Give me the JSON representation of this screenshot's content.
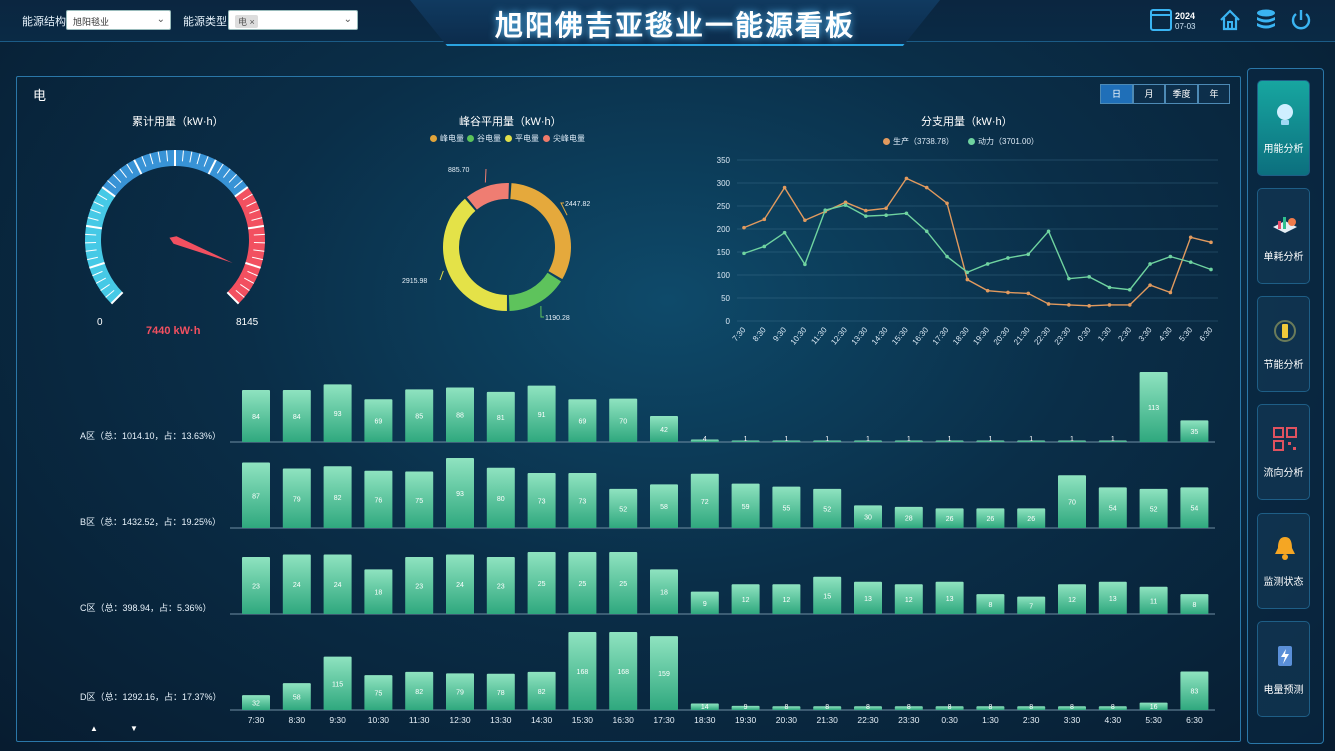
{
  "header": {
    "title": "旭阳佛吉亚毯业一能源看板",
    "structure_label": "能源结构",
    "structure_value": "旭阳毯业",
    "type_label": "能源类型",
    "type_value": "电",
    "date_year": "2024",
    "date_md": "07-03",
    "icons": [
      "calendar-icon",
      "home-icon",
      "database-icon",
      "power-icon"
    ]
  },
  "panel": {
    "title": "电",
    "periods": [
      "日",
      "月",
      "季度",
      "年"
    ],
    "active_period": "日"
  },
  "sidebar": [
    {
      "label": "用能分析",
      "icon": "bulb-icon",
      "active": true
    },
    {
      "label": "单耗分析",
      "icon": "chart-3d-icon",
      "active": false
    },
    {
      "label": "节能分析",
      "icon": "battery-icon",
      "active": false
    },
    {
      "label": "流向分析",
      "icon": "flow-grid-icon",
      "active": false
    },
    {
      "label": "监测状态",
      "icon": "bell-icon",
      "active": false
    },
    {
      "label": "电量预测",
      "icon": "forecast-icon",
      "active": false
    }
  ],
  "colors": {
    "accent": "#3ab4f2",
    "gauge_red": "#f25060",
    "bar_top": "#8fe3c0",
    "bar_bottom": "#2fa87e",
    "prod": "#e29a5e",
    "power": "#6fd3a0"
  },
  "chart_data": [
    {
      "type": "gauge",
      "title": "累计用量（kW·h）",
      "min": 0,
      "max": 8145,
      "value": 7440,
      "value_label": "7440 kW·h",
      "min_label": "0",
      "max_label": "8145"
    },
    {
      "type": "pie",
      "title": "峰谷平用量（kW·h）",
      "legend": [
        "峰电量",
        "谷电量",
        "平电量",
        "尖峰电量"
      ],
      "legend_colors": [
        "#e0a43a",
        "#5cc35a",
        "#e0e04a",
        "#ef7a6a"
      ],
      "slices": [
        {
          "name": "峰电量",
          "value": 2447.82,
          "label": "2447.82",
          "color": "#e5a93c"
        },
        {
          "name": "谷电量",
          "value": 1190.28,
          "label": "1190.28",
          "color": "#5ec35c"
        },
        {
          "name": "平电量",
          "value": 2915.98,
          "label": "2915.98",
          "color": "#e4e248"
        },
        {
          "name": "尖峰电量",
          "value": 885.7,
          "label": "885.70",
          "color": "#ef7d72"
        }
      ]
    },
    {
      "type": "line",
      "title": "分支用量（kW·h）",
      "legend": [
        "生产（3738.78）",
        "动力（3701.00）"
      ],
      "x": [
        "7:30",
        "8:30",
        "9:30",
        "10:30",
        "11:30",
        "12:30",
        "13:30",
        "14:30",
        "15:30",
        "16:30",
        "17:30",
        "18:30",
        "19:30",
        "20:30",
        "21:30",
        "22:30",
        "23:30",
        "0:30",
        "1:30",
        "2:30",
        "3:30",
        "4:30",
        "5:30",
        "6:30"
      ],
      "yticks": [
        "350",
        "300",
        "250",
        "200",
        "150",
        "100",
        "50",
        "0"
      ],
      "ylim": [
        0,
        350
      ],
      "series": [
        {
          "name": "生产（3738.78）",
          "color": "#e29a5e",
          "values": [
            203,
            221,
            290,
            219,
            238,
            258,
            240,
            245,
            310,
            290,
            256,
            90,
            66,
            62,
            60,
            37,
            35,
            33,
            35,
            35,
            78,
            62,
            182,
            171
          ]
        },
        {
          "name": "动力（3701.00）",
          "color": "#6fd3a0",
          "values": [
            147,
            162,
            192,
            123,
            241,
            252,
            228,
            230,
            234,
            195,
            140,
            106,
            124,
            137,
            145,
            195,
            92,
            96,
            73,
            68,
            124,
            140,
            128,
            112
          ]
        }
      ]
    },
    {
      "type": "bar",
      "zones": [
        {
          "label": "A区（总：1014.10，占：13.63%）",
          "values": [
            84,
            84,
            93,
            69,
            85,
            88,
            81,
            91,
            69,
            70,
            42,
            4,
            1,
            1,
            1,
            1,
            1,
            1,
            1,
            1,
            1,
            1,
            113,
            35
          ],
          "labels": [
            "84",
            "84",
            "93",
            "69",
            "85",
            "88",
            "81",
            "91",
            "69",
            "70",
            "42",
            "4",
            "1",
            "1",
            "1",
            "1",
            "1",
            "1",
            "1",
            "1",
            "1",
            "1",
            "113",
            "35"
          ]
        },
        {
          "label": "B区（总：1432.52，占：19.25%）",
          "values": [
            87,
            79,
            82,
            76,
            75,
            93,
            80,
            73,
            73,
            52,
            58,
            72,
            59,
            55,
            52,
            30,
            28,
            26,
            26,
            26,
            70,
            54,
            52,
            54
          ],
          "labels": [
            "87",
            "79",
            "82",
            "76",
            "75",
            "93",
            "80",
            "73",
            "73",
            "52",
            "58",
            "72",
            "59",
            "55",
            "52",
            "30",
            "28",
            "26",
            "26",
            "26",
            "70",
            "54",
            "52",
            "54"
          ]
        },
        {
          "label": "C区（总：398.94，占：5.36%）",
          "values": [
            23,
            24,
            24,
            18,
            23,
            24,
            23,
            25,
            25,
            25,
            18,
            9,
            12,
            12,
            15,
            13,
            12,
            13,
            8,
            7,
            12,
            13,
            11,
            8
          ],
          "labels": [
            "23",
            "24",
            "24",
            "18",
            "23",
            "24",
            "23",
            "25",
            "25",
            "25",
            "18",
            "9",
            "12",
            "12",
            "15",
            "13",
            "12",
            "13",
            "8",
            "7",
            "12",
            "13",
            "11",
            "8"
          ]
        },
        {
          "label": "D区（总：1292.16，占：17.37%）",
          "values": [
            32,
            58,
            115,
            75,
            82,
            79,
            78,
            82,
            168,
            168,
            159,
            14,
            9,
            8,
            8,
            8,
            8,
            8,
            8,
            8,
            8,
            8,
            16,
            83
          ],
          "labels": [
            "32",
            "58",
            "115",
            "75",
            "82",
            "79",
            "78",
            "82",
            "168",
            "168",
            "159",
            "14",
            "9",
            "8",
            "8",
            "8",
            "8",
            "8",
            "8",
            "8",
            "8",
            "8",
            "16",
            "83"
          ]
        }
      ],
      "x": [
        "7:30",
        "8:30",
        "9:30",
        "10:30",
        "11:30",
        "12:30",
        "13:30",
        "14:30",
        "15:30",
        "16:30",
        "17:30",
        "18:30",
        "19:30",
        "20:30",
        "21:30",
        "22:30",
        "23:30",
        "0:30",
        "1:30",
        "2:30",
        "3:30",
        "4:30",
        "5:30",
        "6:30"
      ]
    }
  ]
}
